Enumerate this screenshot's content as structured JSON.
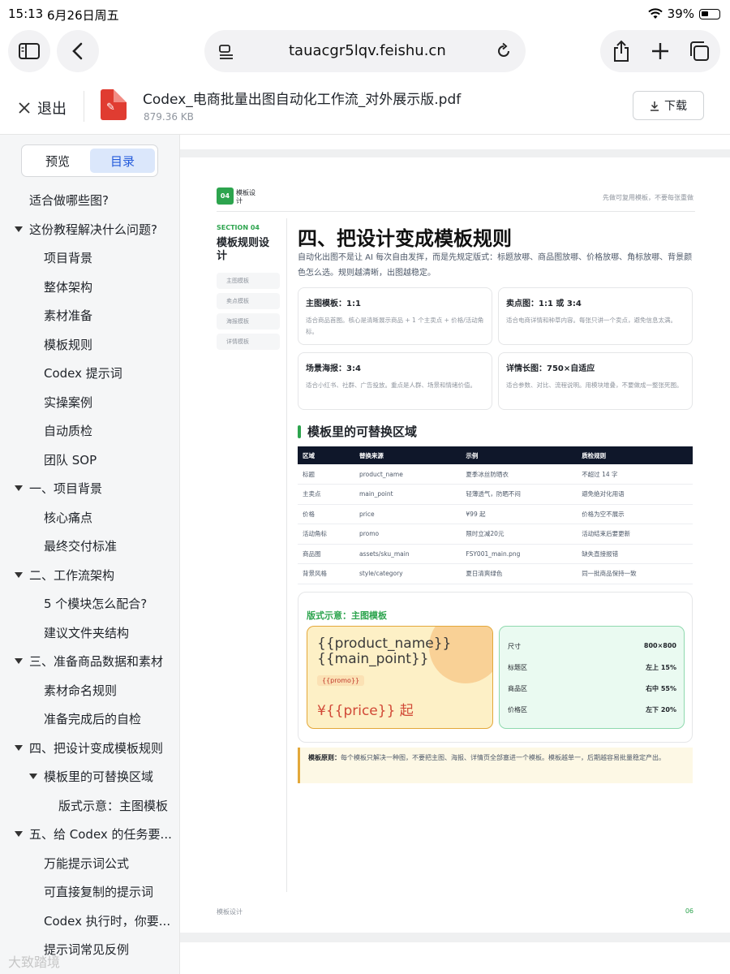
{
  "status": {
    "time": "15:13",
    "date": "6月26日周五",
    "battery": "39%"
  },
  "browser": {
    "url": "tauacgr5lqv.feishu.cn"
  },
  "filebar": {
    "exit_label": "退出",
    "file_name": "Codex_电商批量出图自动化工作流_对外展示版.pdf",
    "file_size": "879.36 KB",
    "download_label": "下载"
  },
  "sidebar": {
    "tabs": [
      "预览",
      "目录"
    ],
    "items": [
      {
        "label": "适合做哪些图?",
        "level": 0,
        "caret": false
      },
      {
        "label": "这份教程解决什么问题?",
        "level": 0,
        "caret": true
      },
      {
        "label": "项目背景",
        "level": 1,
        "caret": false
      },
      {
        "label": "整体架构",
        "level": 1,
        "caret": false
      },
      {
        "label": "素材准备",
        "level": 1,
        "caret": false
      },
      {
        "label": "模板规则",
        "level": 1,
        "caret": false
      },
      {
        "label": "Codex 提示词",
        "level": 1,
        "caret": false
      },
      {
        "label": "实操案例",
        "level": 1,
        "caret": false
      },
      {
        "label": "自动质检",
        "level": 1,
        "caret": false
      },
      {
        "label": "团队 SOP",
        "level": 1,
        "caret": false
      },
      {
        "label": "一、项目背景",
        "level": 0,
        "caret": true
      },
      {
        "label": "核心痛点",
        "level": 1,
        "caret": false
      },
      {
        "label": "最终交付标准",
        "level": 1,
        "caret": false
      },
      {
        "label": "二、工作流架构",
        "level": 0,
        "caret": true
      },
      {
        "label": "5 个模块怎么配合?",
        "level": 1,
        "caret": false
      },
      {
        "label": "建议文件夹结构",
        "level": 1,
        "caret": false
      },
      {
        "label": "三、准备商品数据和素材",
        "level": 0,
        "caret": true
      },
      {
        "label": "素材命名规则",
        "level": 1,
        "caret": false
      },
      {
        "label": "准备完成后的自检",
        "level": 1,
        "caret": false
      },
      {
        "label": "四、把设计变成模板规则",
        "level": 0,
        "caret": true
      },
      {
        "label": "模板里的可替换区域",
        "level": 1,
        "caret": true
      },
      {
        "label": "版式示意：主图模板",
        "level": 2,
        "caret": false
      },
      {
        "label": "五、给 Codex 的任务要...",
        "level": 0,
        "caret": true
      },
      {
        "label": "万能提示词公式",
        "level": 1,
        "caret": false
      },
      {
        "label": "可直接复制的提示词",
        "level": 1,
        "caret": false
      },
      {
        "label": "Codex 执行时，你要...",
        "level": 1,
        "caret": false
      },
      {
        "label": "提示词常见反例",
        "level": 1,
        "caret": false
      }
    ],
    "watermark": "大致踏境"
  },
  "page": {
    "badge": "04",
    "header_label": "模板设计",
    "header_right": "先做可复用模板，不要每张重做",
    "section_label": "SECTION 04",
    "section_title": "模板规则设计",
    "section_chips": [
      "主图模板",
      "卖点模板",
      "海报模板",
      "详情模板"
    ],
    "title": "四、把设计变成模板规则",
    "intro": "自动化出图不是让 AI 每次自由发挥，而是先规定版式：标题放哪、商品图放哪、价格放哪、角标放哪、背景颜色怎么选。规则越清晰，出图越稳定。",
    "cards": [
      {
        "title": "主图模板：1:1",
        "desc": "适合商品首图。核心是清晰展示商品 + 1 个主卖点 + 价格/活动角标。"
      },
      {
        "title": "卖点图：1:1 或 3:4",
        "desc": "适合电商详情和种草内容。每张只讲一个卖点，避免信息太满。"
      },
      {
        "title": "场景海报：3:4",
        "desc": "适合小红书、社群、广告投放。重点是人群、场景和情绪价值。"
      },
      {
        "title": "详情长图：750×自适应",
        "desc": "适合参数、对比、流程说明。用模块堆叠，不要做成一整张死图。"
      }
    ],
    "subheading": "模板里的可替换区域",
    "table": {
      "headers": [
        "区域",
        "替换来源",
        "示例",
        "质检规则"
      ],
      "rows": [
        [
          "标题",
          "product_name",
          "夏季冰丝防晒衣",
          "不超过 14 字"
        ],
        [
          "主卖点",
          "main_point",
          "轻薄透气，防晒不闷",
          "避免绝对化用语"
        ],
        [
          "价格",
          "price",
          "¥99 起",
          "价格为空不展示"
        ],
        [
          "活动角标",
          "promo",
          "限时立减20元",
          "活动结束后要更新"
        ],
        [
          "商品图",
          "assets/sku_main",
          "FSY001_main.png",
          "缺失直接报错"
        ],
        [
          "背景风格",
          "style/category",
          "夏日清爽绿色",
          "同一批商品保持一致"
        ]
      ]
    },
    "demo": {
      "title": "版式示意：主图模板",
      "product_name": "{{product_name}}",
      "main_point": "{{main_point}}",
      "promo": "{{promo}}",
      "price": "¥{{price}} 起",
      "spec": [
        {
          "k": "尺寸",
          "v": "800×800"
        },
        {
          "k": "标题区",
          "v": "左上 15%"
        },
        {
          "k": "商品区",
          "v": "右中 55%"
        },
        {
          "k": "价格区",
          "v": "左下 20%"
        }
      ]
    },
    "note_bold": "模板原则：",
    "note_text": "每个模板只解决一种图，不要把主图、海报、详情页全部塞进一个模板。模板越单一，后期越容易批量稳定产出。",
    "footer_left": "模板设计",
    "footer_right": "06"
  }
}
